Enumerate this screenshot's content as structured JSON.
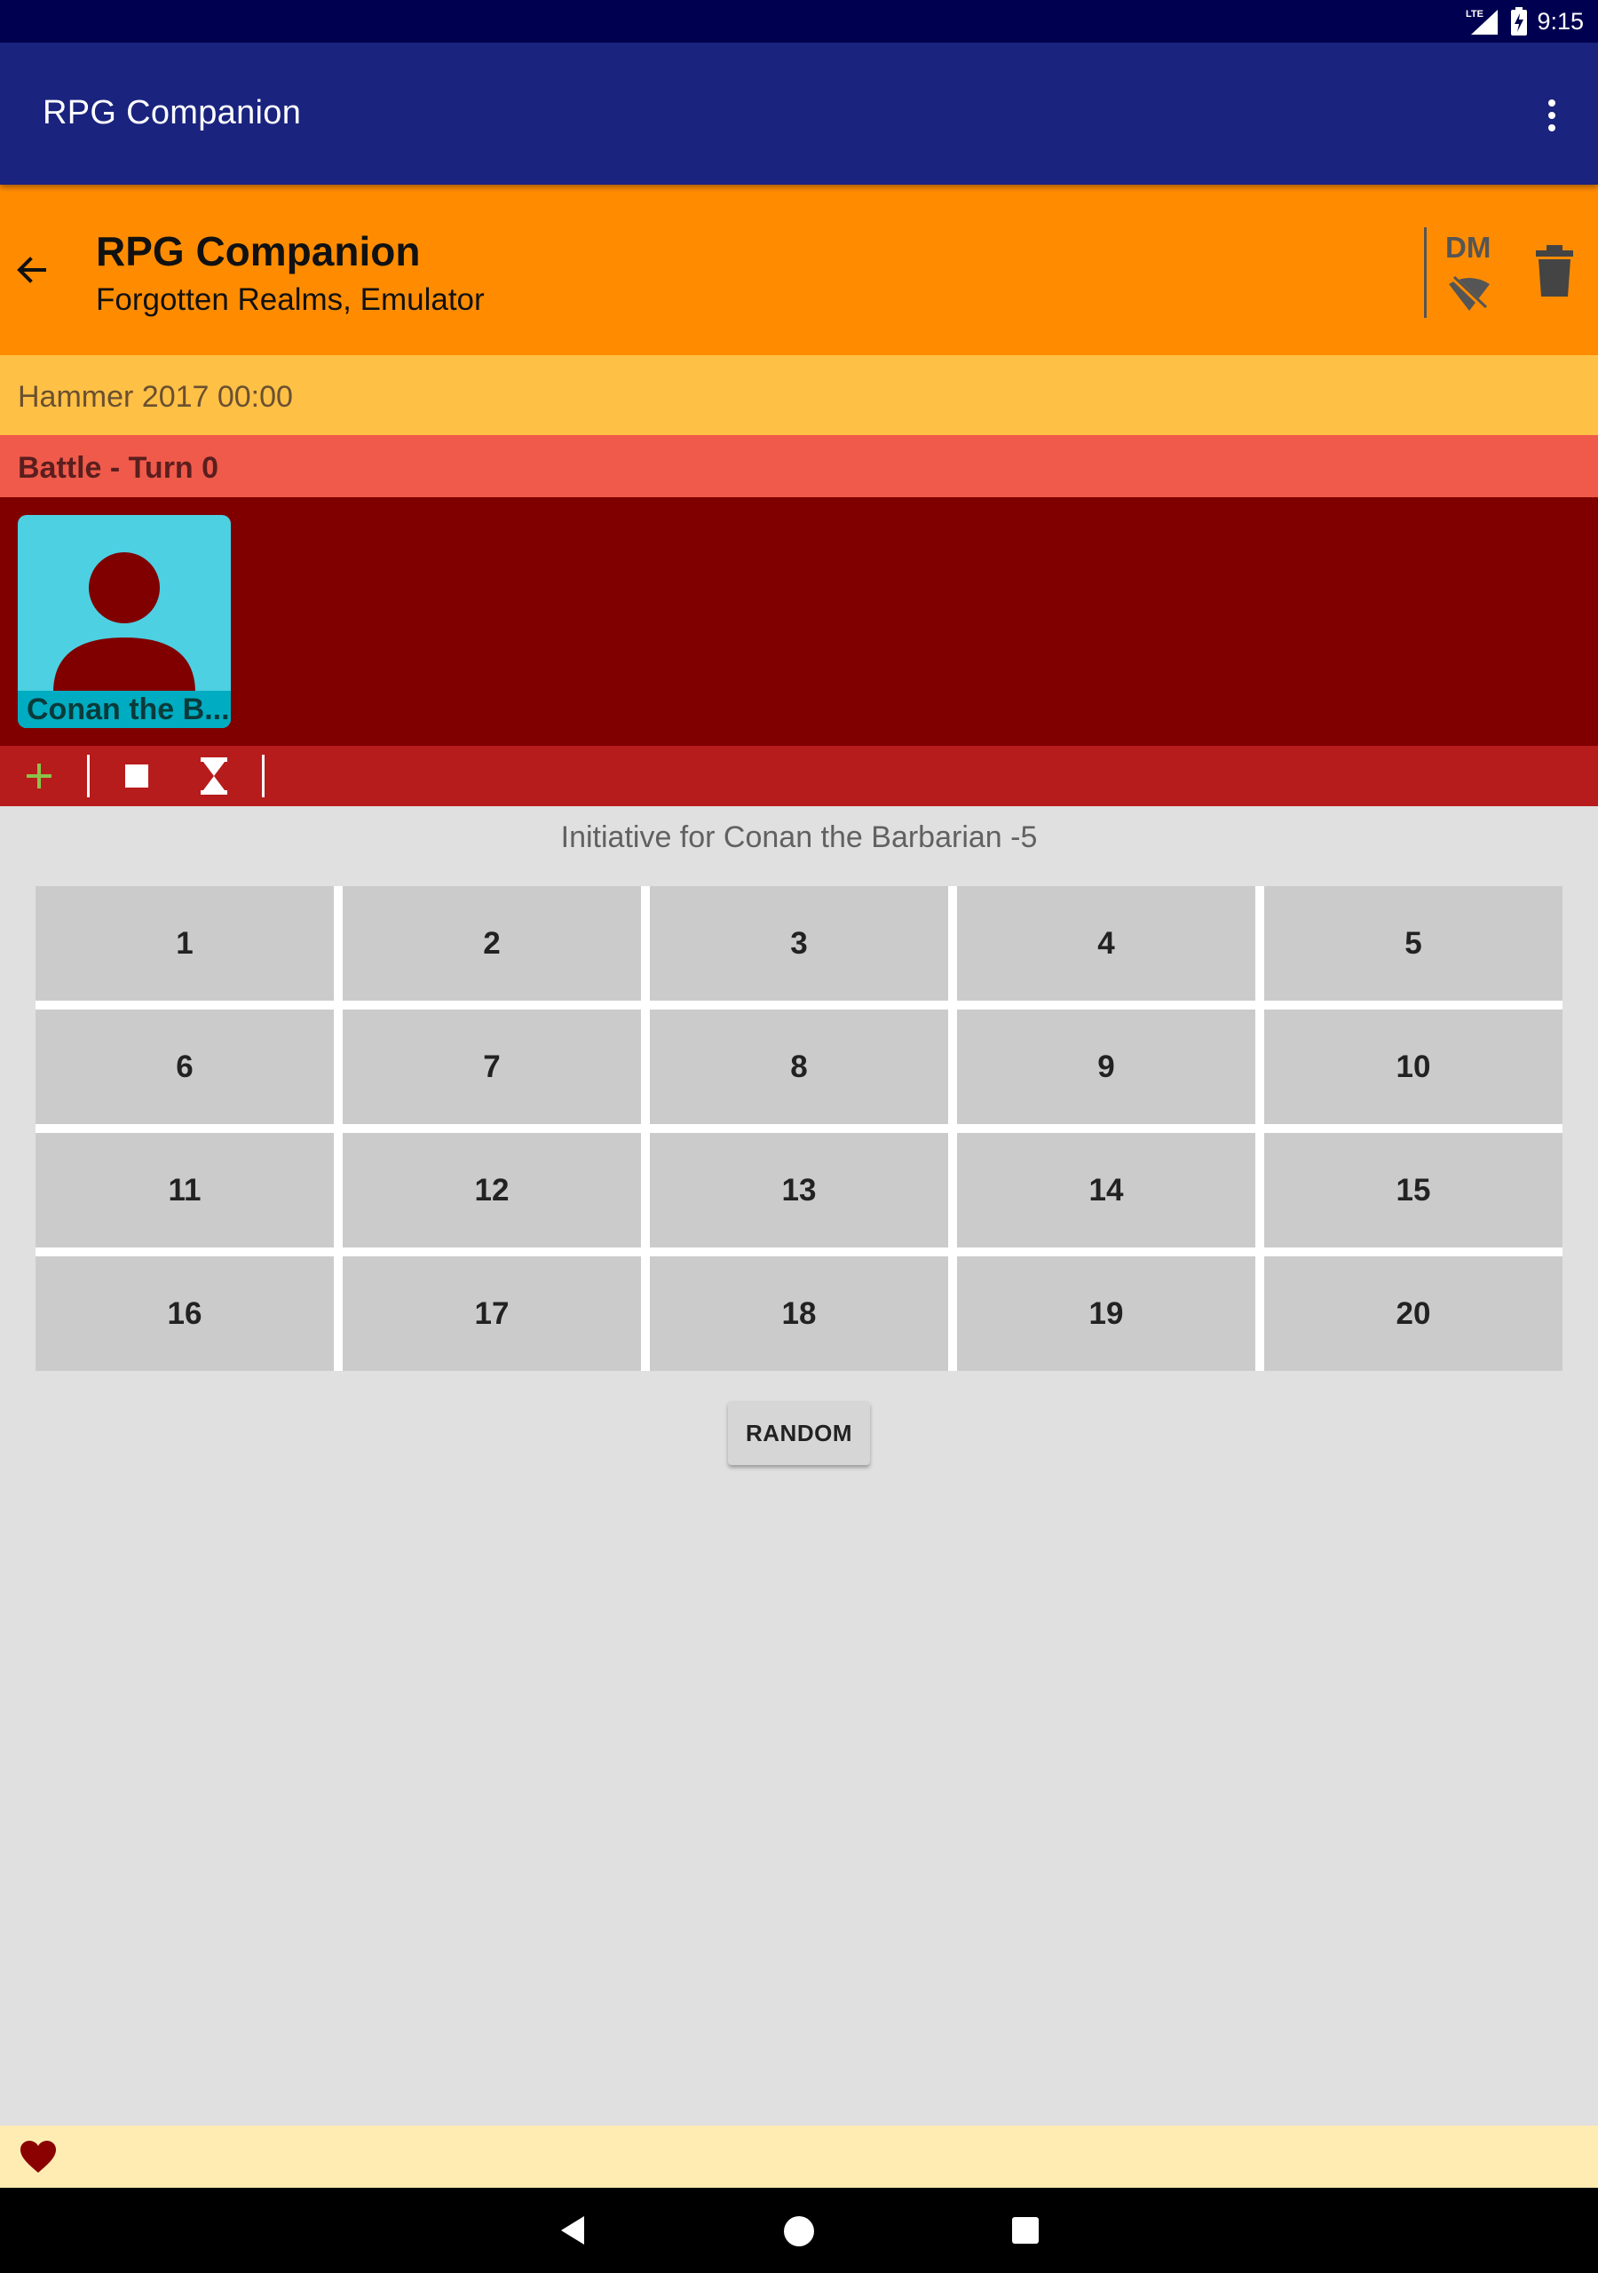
{
  "status_bar": {
    "network": "LTE",
    "time": "9:15"
  },
  "app_bar": {
    "title": "RPG Companion"
  },
  "campaign": {
    "title": "RPG Companion",
    "subtitle": "Forgotten Realms, Emulator",
    "dm_label": "DM"
  },
  "date": {
    "text": "Hammer 2017 00:00"
  },
  "battle": {
    "text": "Battle - Turn 0"
  },
  "combatants": [
    {
      "name": "Conan the B..."
    }
  ],
  "initiative": {
    "label": "Initiative for Conan the Barbarian  -5"
  },
  "numbers": [
    [
      "1",
      "2",
      "3",
      "4",
      "5"
    ],
    [
      "6",
      "7",
      "8",
      "9",
      "10"
    ],
    [
      "11",
      "12",
      "13",
      "14",
      "15"
    ],
    [
      "16",
      "17",
      "18",
      "19",
      "20"
    ]
  ],
  "random_button": {
    "label": "RANDOM"
  },
  "colors": {
    "status_bar": "#000050",
    "app_bar": "#1a237e",
    "campaign_bar": "#ff8c00",
    "date_bar": "#ffc046",
    "battle_bar": "#ef5a4a",
    "combatant_area": "#800000",
    "toolbar": "#b71c1c",
    "card": "#4dd0e1",
    "footer": "#ffecb3"
  },
  "icons": [
    "signal-icon",
    "battery-charging-icon",
    "overflow-menu-icon",
    "back-arrow-icon",
    "wifi-off-icon",
    "trash-icon",
    "avatar-icon",
    "add-icon",
    "stop-icon",
    "hourglass-icon",
    "heart-icon",
    "nav-back-icon",
    "nav-home-icon",
    "nav-recents-icon"
  ]
}
